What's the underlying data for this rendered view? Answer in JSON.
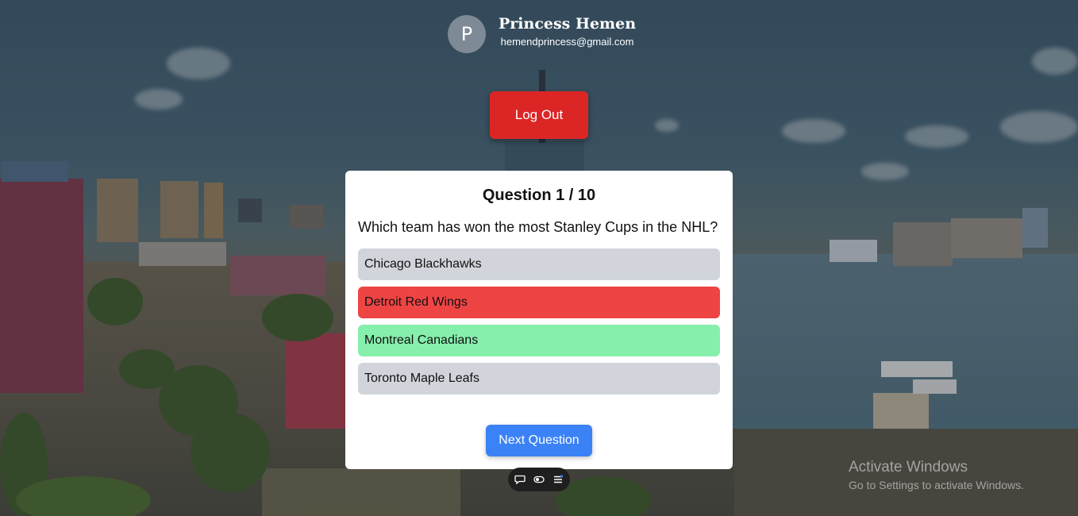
{
  "profile": {
    "avatar_initial": "P",
    "name": "Princess Hemen",
    "email": "hemendprincess@gmail.com"
  },
  "actions": {
    "logout_label": "Log Out",
    "next_label": "Next Question"
  },
  "quiz": {
    "progress_label": "Question 1 / 10",
    "question": "Which team has won the most Stanley Cups in the NHL?",
    "options": [
      {
        "label": "Chicago Blackhawks",
        "state": "neutral"
      },
      {
        "label": "Detroit Red Wings",
        "state": "wrong"
      },
      {
        "label": "Montreal Canadians",
        "state": "correct"
      },
      {
        "label": "Toronto Maple Leafs",
        "state": "neutral"
      }
    ]
  },
  "toolbar": {
    "icons": [
      "chat-icon",
      "toggle-icon",
      "menu-icon"
    ]
  },
  "watermark": {
    "title": "Activate Windows",
    "subtitle": "Go to Settings to activate Windows."
  },
  "colors": {
    "logout": "#dc2626",
    "next": "#3b82f6",
    "neutral": "#d1d5db",
    "wrong": "#ef4444",
    "correct": "#86efac"
  }
}
